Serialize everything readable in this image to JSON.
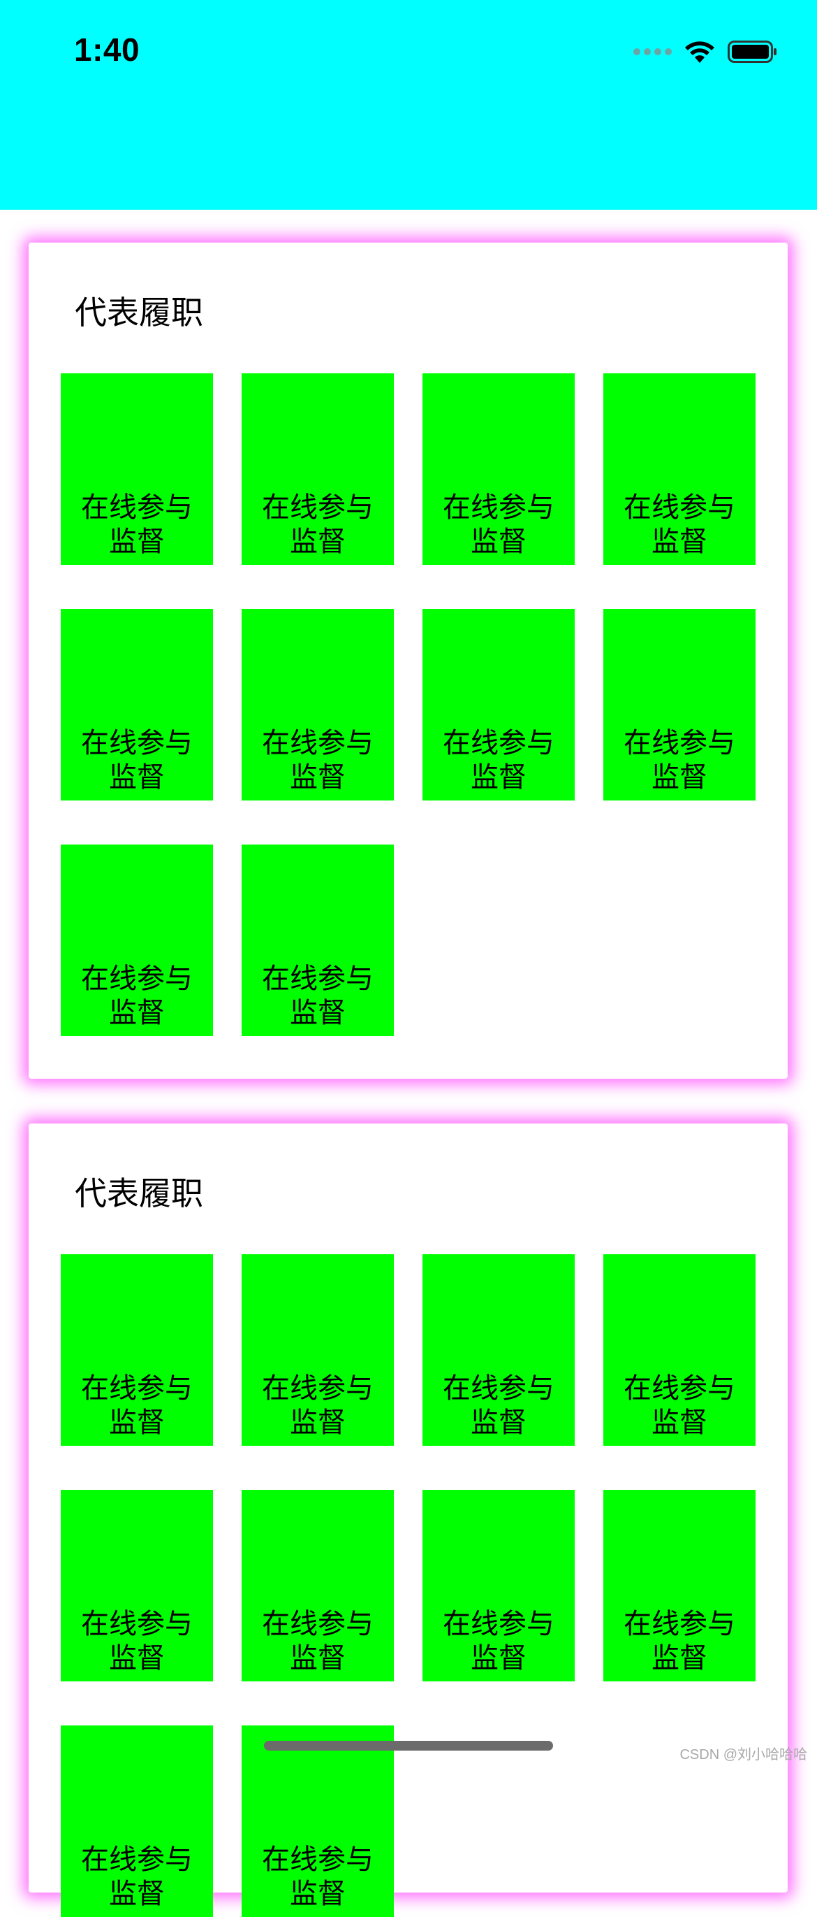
{
  "status_bar": {
    "time": "1:40",
    "icons": [
      "signal-dots-icon",
      "wifi-icon",
      "battery-icon"
    ]
  },
  "colors": {
    "header_bg": "#00ffff",
    "tile_bg": "#00ff00",
    "card_glow": "#ff00ff",
    "page_bg": "#ffffff"
  },
  "sections": [
    {
      "title": "代表履职",
      "items": [
        {
          "label": "在线参与\n监督"
        },
        {
          "label": "在线参与\n监督"
        },
        {
          "label": "在线参与\n监督"
        },
        {
          "label": "在线参与\n监督"
        },
        {
          "label": "在线参与\n监督"
        },
        {
          "label": "在线参与\n监督"
        },
        {
          "label": "在线参与\n监督"
        },
        {
          "label": "在线参与\n监督"
        },
        {
          "label": "在线参与\n监督"
        },
        {
          "label": "在线参与\n监督"
        }
      ]
    },
    {
      "title": "代表履职",
      "items": [
        {
          "label": "在线参与\n监督"
        },
        {
          "label": "在线参与\n监督"
        },
        {
          "label": "在线参与\n监督"
        },
        {
          "label": "在线参与\n监督"
        },
        {
          "label": "在线参与\n监督"
        },
        {
          "label": "在线参与\n监督"
        },
        {
          "label": "在线参与\n监督"
        },
        {
          "label": "在线参与\n监督"
        },
        {
          "label": "在线参与\n监督"
        },
        {
          "label": "在线参与\n监督"
        }
      ]
    }
  ],
  "watermark": "CSDN @刘小哈哈哈"
}
